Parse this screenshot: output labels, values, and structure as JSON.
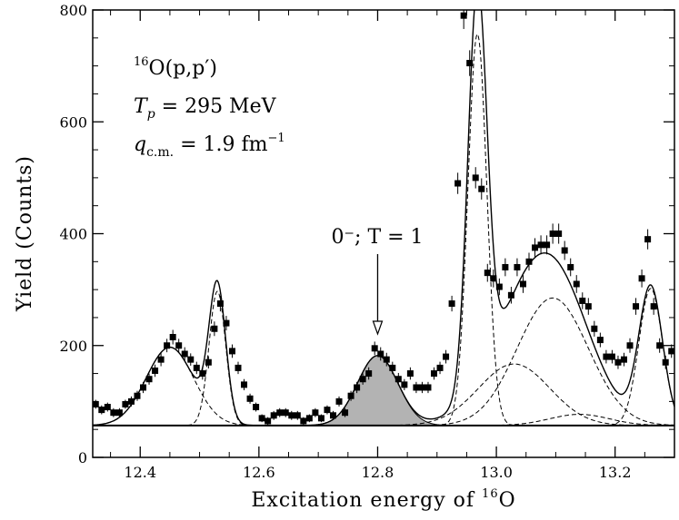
{
  "chart_data": {
    "type": "scatter",
    "xlabel_prefix": "Excitation energy of ",
    "xlabel_sup": "16",
    "xlabel_suffix": "O",
    "ylabel": "Yield (Counts)",
    "xlim": [
      12.32,
      13.3
    ],
    "ylim": [
      0,
      800
    ],
    "x_ticks": [
      "12.4",
      "12.6",
      "12.8",
      "13.0",
      "13.2"
    ],
    "x_tick_values": [
      12.4,
      12.6,
      12.8,
      13.0,
      13.2
    ],
    "y_ticks": [
      "0",
      "200",
      "400",
      "600",
      "800"
    ],
    "y_tick_values": [
      0,
      200,
      400,
      600,
      800
    ],
    "grid": false,
    "annotations": {
      "reaction": {
        "sup": "16",
        "text": "O(p,p′)"
      },
      "energy": {
        "main": "T",
        "sub": "p",
        "rest": " = 295 MeV"
      },
      "momentum": {
        "main": "q",
        "sub": "c.m.",
        "rest": " = 1.9 fm",
        "sup": "−1"
      },
      "state_label": "0⁻; T = 1",
      "state_arrow_x": 12.8
    },
    "background_level": 57,
    "series": [
      {
        "kind": "data-points",
        "x": [
          12.325,
          12.335,
          12.345,
          12.355,
          12.365,
          12.375,
          12.385,
          12.395,
          12.405,
          12.415,
          12.425,
          12.435,
          12.445,
          12.455,
          12.465,
          12.475,
          12.485,
          12.495,
          12.505,
          12.515,
          12.525,
          12.535,
          12.545,
          12.555,
          12.565,
          12.575,
          12.585,
          12.595,
          12.605,
          12.615,
          12.625,
          12.635,
          12.645,
          12.655,
          12.665,
          12.675,
          12.685,
          12.695,
          12.705,
          12.715,
          12.725,
          12.735,
          12.745,
          12.755,
          12.765,
          12.775,
          12.785,
          12.795,
          12.805,
          12.815,
          12.825,
          12.835,
          12.845,
          12.855,
          12.865,
          12.875,
          12.885,
          12.895,
          12.905,
          12.915,
          12.925,
          12.935,
          12.945,
          12.955,
          12.965,
          12.975,
          12.985,
          12.995,
          13.005,
          13.015,
          13.025,
          13.035,
          13.045,
          13.055,
          13.065,
          13.075,
          13.085,
          13.095,
          13.105,
          13.115,
          13.125,
          13.135,
          13.145,
          13.155,
          13.165,
          13.175,
          13.185,
          13.195,
          13.205,
          13.215,
          13.225,
          13.235,
          13.245,
          13.255,
          13.265,
          13.275,
          13.285,
          13.295
        ],
        "y": [
          95,
          85,
          90,
          80,
          80,
          95,
          100,
          110,
          125,
          140,
          155,
          175,
          200,
          215,
          200,
          185,
          175,
          160,
          150,
          170,
          230,
          275,
          240,
          190,
          160,
          130,
          105,
          90,
          70,
          65,
          75,
          80,
          80,
          75,
          75,
          65,
          70,
          80,
          70,
          85,
          75,
          100,
          80,
          110,
          125,
          140,
          150,
          195,
          185,
          175,
          160,
          140,
          130,
          150,
          125,
          125,
          125,
          150,
          160,
          180,
          275,
          490,
          790,
          705,
          500,
          480,
          330,
          320,
          305,
          340,
          290,
          340,
          310,
          350,
          375,
          380,
          380,
          400,
          400,
          370,
          340,
          310,
          280,
          270,
          230,
          210,
          180,
          180,
          170,
          175,
          200,
          270,
          320,
          390,
          270,
          200,
          170,
          190
        ],
        "err": [
          8,
          8,
          8,
          8,
          8,
          8,
          9,
          9,
          10,
          10,
          11,
          12,
          12,
          13,
          12,
          12,
          11,
          11,
          11,
          11,
          13,
          14,
          13,
          12,
          11,
          10,
          9,
          8,
          7,
          7,
          8,
          8,
          8,
          8,
          8,
          7,
          7,
          8,
          7,
          8,
          8,
          9,
          8,
          9,
          10,
          10,
          11,
          12,
          12,
          12,
          11,
          11,
          10,
          11,
          10,
          10,
          10,
          11,
          11,
          12,
          14,
          19,
          24,
          23,
          19,
          19,
          16,
          16,
          15,
          16,
          15,
          16,
          16,
          16,
          17,
          17,
          17,
          18,
          18,
          17,
          16,
          16,
          15,
          15,
          14,
          13,
          12,
          12,
          12,
          12,
          13,
          15,
          16,
          18,
          15,
          13,
          12,
          12
        ]
      },
      {
        "name": "",
        "kind": "gaussian",
        "center": 12.45,
        "amplitude": 140,
        "sigma": 0.04,
        "style": "dashed"
      },
      {
        "name": "",
        "kind": "gaussian",
        "center": 12.53,
        "amplitude": 240,
        "sigma": 0.014,
        "style": "dashed"
      },
      {
        "name": "",
        "kind": "gaussian",
        "center": 12.8,
        "amplitude": 125,
        "sigma": 0.034,
        "style": "filled"
      },
      {
        "name": "",
        "kind": "gaussian",
        "center": 12.968,
        "amplitude": 700,
        "sigma": 0.016,
        "style": "dashed"
      },
      {
        "name": "",
        "kind": "gaussian",
        "center": 13.03,
        "amplitude": 110,
        "sigma": 0.06,
        "style": "dashed"
      },
      {
        "name": "",
        "kind": "gaussian",
        "center": 13.095,
        "amplitude": 228,
        "sigma": 0.06,
        "style": "dashed"
      },
      {
        "name": "",
        "kind": "gaussian",
        "center": 13.14,
        "amplitude": 20,
        "sigma": 0.05,
        "style": "dashed"
      },
      {
        "name": "",
        "kind": "gaussian",
        "center": 13.26,
        "amplitude": 245,
        "sigma": 0.02,
        "style": "dashed"
      }
    ]
  }
}
